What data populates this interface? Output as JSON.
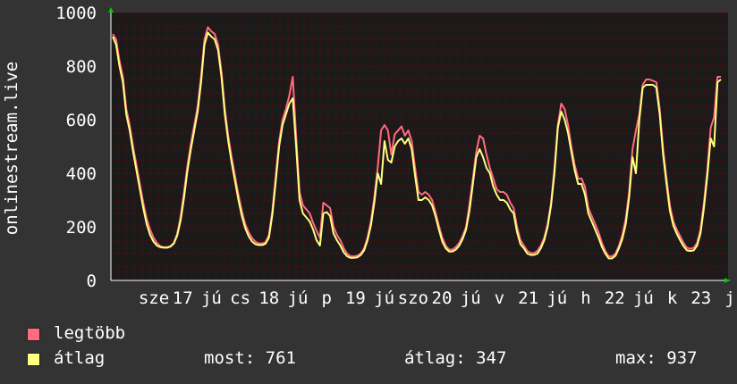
{
  "chart_data": {
    "type": "line",
    "ylabel": "onlinestream.live",
    "ylim": [
      0,
      1000
    ],
    "y_ticks": [
      0,
      200,
      400,
      600,
      800,
      1000
    ],
    "x_tick_labels": [
      "sze",
      "17",
      "jú",
      "cs",
      "18",
      "jú",
      "p",
      "19",
      "jú",
      "szo",
      "20",
      "jú",
      "v",
      "21",
      "jú",
      "h",
      "22",
      "jú",
      "k",
      "23",
      "j"
    ],
    "grid": true,
    "legend_placement": "bottom",
    "colors": {
      "legtobb": "#ff6c80",
      "atlag": "#ffff80",
      "background": "#333333",
      "plot_background": "#1a1a1a",
      "grid": "#8b0000",
      "axis": "#ffffff"
    },
    "series": [
      {
        "name": "legtöbb",
        "values": [
          920,
          900,
          820,
          760,
          640,
          580,
          500,
          430,
          360,
          290,
          230,
          190,
          160,
          140,
          128,
          124,
          124,
          128,
          140,
          175,
          240,
          330,
          430,
          510,
          580,
          650,
          760,
          900,
          945,
          930,
          920,
          880,
          780,
          640,
          540,
          460,
          390,
          320,
          260,
          210,
          180,
          158,
          144,
          138,
          138,
          142,
          170,
          260,
          390,
          520,
          600,
          640,
          690,
          760,
          540,
          330,
          280,
          265,
          250,
          215,
          185,
          160,
          290,
          280,
          270,
          200,
          170,
          150,
          120,
          100,
          90,
          90,
          92,
          100,
          120,
          160,
          220,
          310,
          420,
          560,
          580,
          560,
          470,
          545,
          560,
          575,
          540,
          560,
          520,
          420,
          330,
          320,
          330,
          320,
          300,
          255,
          205,
          160,
          130,
          115,
          115,
          125,
          140,
          165,
          200,
          285,
          380,
          480,
          540,
          530,
          470,
          420,
          380,
          340,
          330,
          330,
          320,
          290,
          270,
          200,
          150,
          130,
          110,
          102,
          102,
          110,
          130,
          160,
          210,
          290,
          420,
          580,
          660,
          640,
          580,
          500,
          430,
          380,
          380,
          350,
          270,
          240,
          210,
          180,
          140,
          110,
          90,
          90,
          100,
          130,
          170,
          230,
          330,
          490,
          560,
          620,
          730,
          750,
          750,
          745,
          740,
          640,
          490,
          380,
          280,
          220,
          190,
          165,
          140,
          122,
          118,
          122,
          140,
          190,
          290,
          410,
          570,
          610,
          760,
          760
        ]
      },
      {
        "name": "átlag",
        "values": [
          910,
          880,
          800,
          740,
          620,
          560,
          480,
          410,
          340,
          270,
          210,
          170,
          145,
          130,
          124,
          122,
          122,
          126,
          138,
          168,
          225,
          310,
          410,
          490,
          560,
          630,
          740,
          880,
          925,
          910,
          900,
          860,
          760,
          620,
          520,
          440,
          370,
          300,
          240,
          195,
          165,
          145,
          135,
          132,
          132,
          137,
          160,
          245,
          370,
          500,
          580,
          620,
          660,
          680,
          500,
          300,
          250,
          235,
          220,
          190,
          150,
          130,
          250,
          255,
          240,
          175,
          150,
          130,
          105,
          90,
          84,
          84,
          86,
          95,
          112,
          150,
          205,
          290,
          400,
          360,
          520,
          450,
          440,
          500,
          520,
          530,
          510,
          530,
          490,
          390,
          300,
          300,
          310,
          300,
          280,
          240,
          190,
          145,
          120,
          108,
          108,
          115,
          130,
          155,
          190,
          260,
          360,
          460,
          490,
          460,
          420,
          400,
          350,
          320,
          300,
          300,
          290,
          265,
          250,
          180,
          135,
          120,
          100,
          95,
          95,
          100,
          120,
          150,
          200,
          280,
          400,
          570,
          630,
          600,
          550,
          480,
          410,
          360,
          360,
          320,
          250,
          220,
          190,
          160,
          125,
          100,
          82,
          82,
          92,
          120,
          155,
          210,
          310,
          460,
          400,
          600,
          720,
          730,
          730,
          730,
          720,
          620,
          470,
          360,
          260,
          205,
          175,
          150,
          128,
          112,
          110,
          112,
          130,
          175,
          270,
          390,
          530,
          500,
          740,
          750
        ]
      }
    ]
  },
  "legend": {
    "items": [
      {
        "label": "legtöbb",
        "color": "#ff6c80"
      },
      {
        "label": "átlag",
        "color": "#ffff80"
      }
    ],
    "stats": {
      "most": "most: 761",
      "atlag": "átlag: 347",
      "max": "max: 937"
    }
  }
}
